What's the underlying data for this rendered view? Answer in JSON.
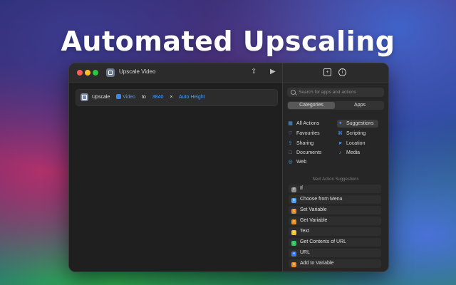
{
  "headline": "Automated Upscaling",
  "window": {
    "title": "Upscale Video",
    "toolbar": {
      "share_icon": "share-icon",
      "run_icon": "play-icon"
    },
    "action": {
      "verb": "Upscale",
      "input_token": "Video",
      "to_label": "to",
      "width_token": "3840",
      "times_label": "×",
      "height_token": "Auto Height"
    }
  },
  "sidebar": {
    "search_placeholder": "Search for apps and actions",
    "segments": {
      "categories": "Categories",
      "apps": "Apps"
    },
    "categories_left": [
      {
        "label": "All Actions",
        "icon": "grid-icon"
      },
      {
        "label": "Favourites",
        "icon": "heart-icon"
      },
      {
        "label": "Sharing",
        "icon": "share-icon"
      },
      {
        "label": "Documents",
        "icon": "document-icon"
      },
      {
        "label": "Web",
        "icon": "compass-icon"
      }
    ],
    "categories_right": [
      {
        "label": "Suggestions",
        "icon": "sparkle-icon"
      },
      {
        "label": "Scripting",
        "icon": "script-icon"
      },
      {
        "label": "Location",
        "icon": "location-arrow-icon"
      },
      {
        "label": "Media",
        "icon": "music-note-icon"
      }
    ],
    "suggestions_header": "Next Action Suggestions",
    "suggestions": [
      {
        "label": "If",
        "color": "#8e8e8e"
      },
      {
        "label": "Choose from Menu",
        "color": "#4aa3f0"
      },
      {
        "label": "Set Variable",
        "color": "#f08a24"
      },
      {
        "label": "Get Variable",
        "color": "#f08a24"
      },
      {
        "label": "Text",
        "color": "#f5c518"
      },
      {
        "label": "Get Contents of URL",
        "color": "#34c759"
      },
      {
        "label": "URL",
        "color": "#3478f6"
      },
      {
        "label": "Add to Variable",
        "color": "#f08a24"
      }
    ]
  }
}
